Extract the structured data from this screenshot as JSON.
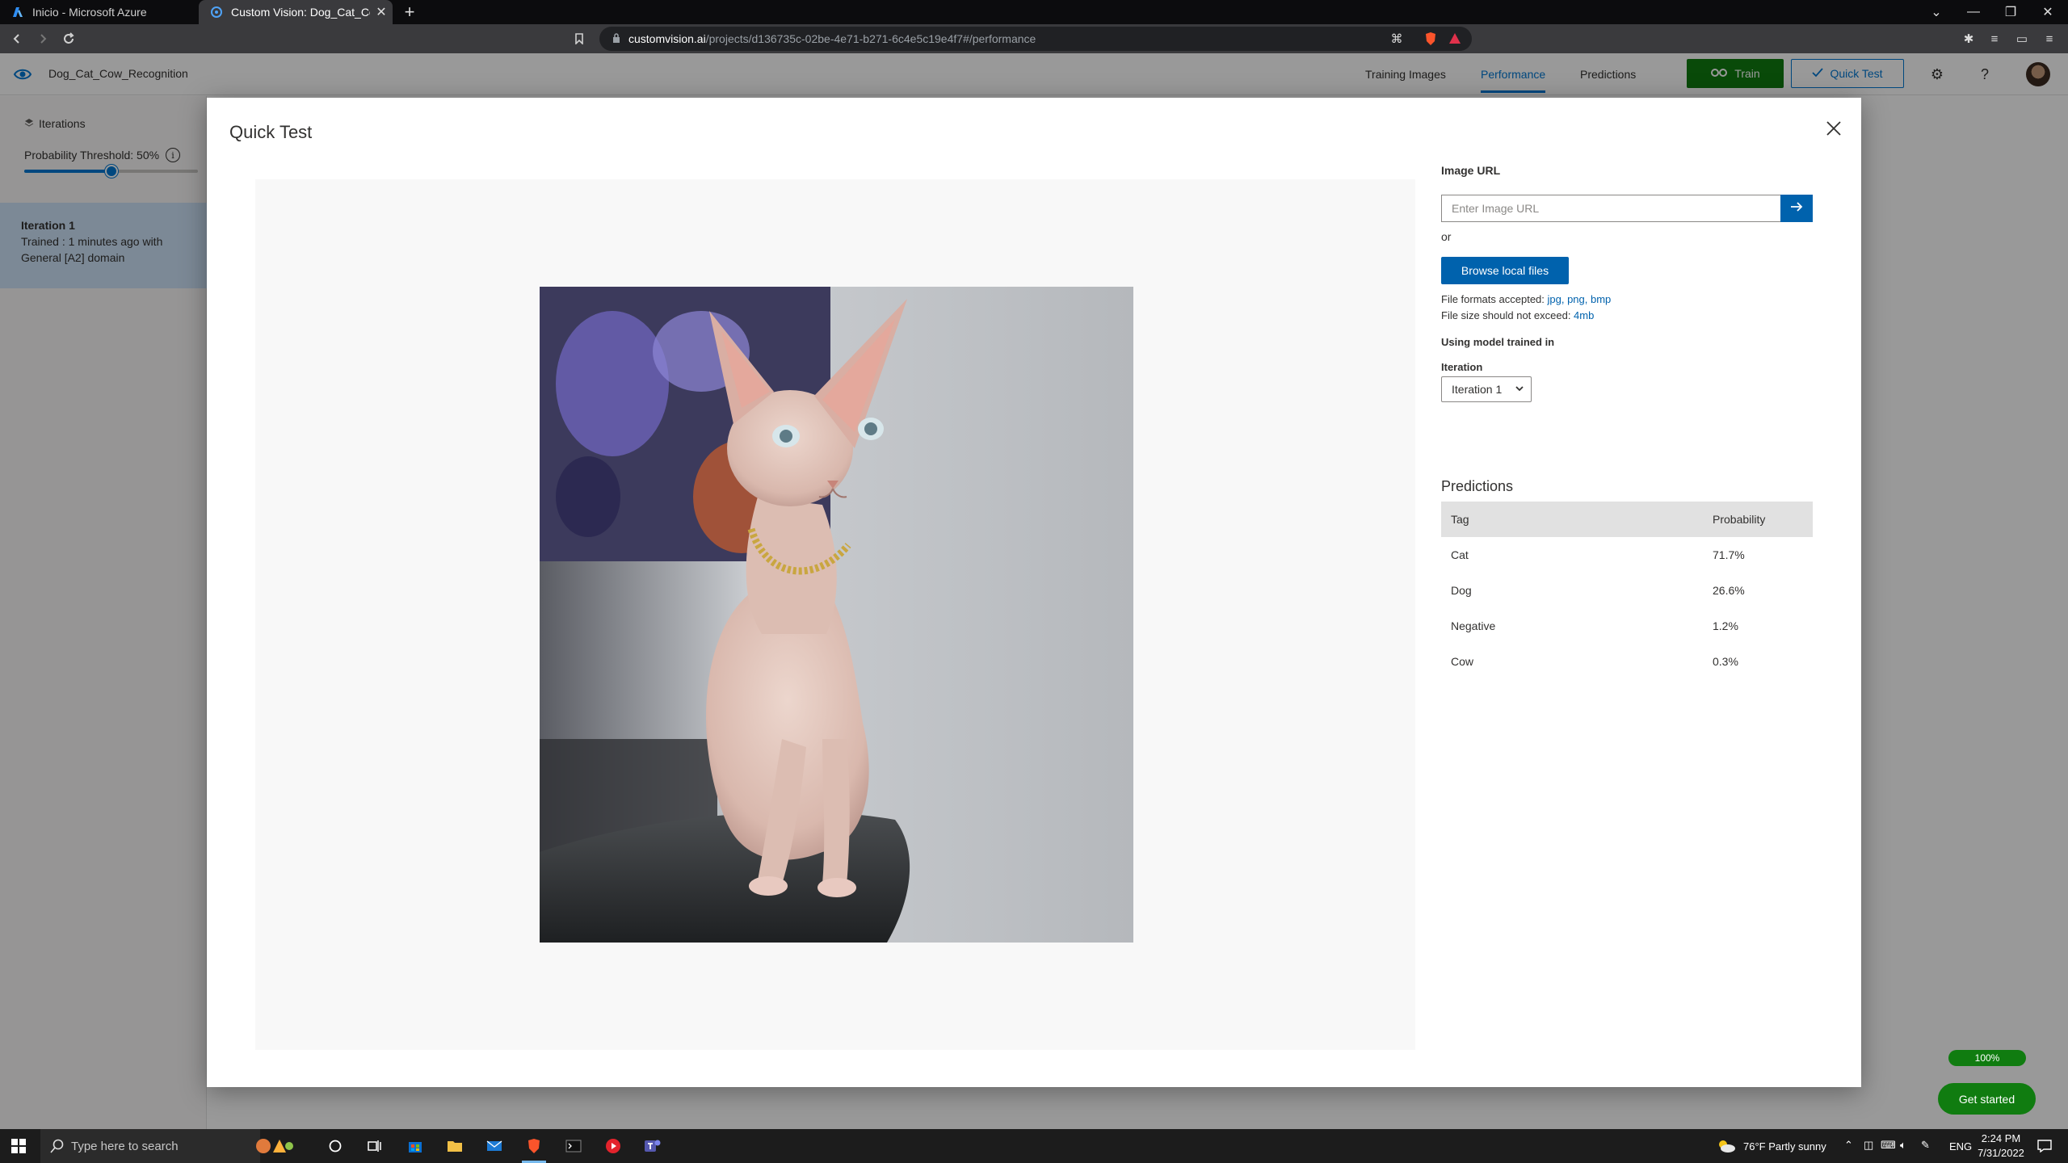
{
  "browser": {
    "tabs": [
      {
        "title": "Inicio - Microsoft Azure",
        "active": false
      },
      {
        "title": "Custom Vision: Dog_Cat_Cow_Re",
        "active": true
      }
    ],
    "url_host": "customvision.ai",
    "url_path": "/projects/d136735c-02be-4e71-b271-6c4e5c19e4f7#/performance"
  },
  "app": {
    "project_name": "Dog_Cat_Cow_Recognition",
    "nav": [
      "Training Images",
      "Performance",
      "Predictions"
    ],
    "active_nav": "Performance",
    "train_label": "Train",
    "quick_test_label": "Quick Test",
    "accent_color": "#0078d4",
    "train_color": "#107c10",
    "sidebar": {
      "iterations_title": "Iterations",
      "threshold_label": "Probability Threshold: 50%",
      "threshold_value": 0.5,
      "iteration": {
        "name": "Iteration 1",
        "trained": "Trained : 1 minutes ago with",
        "domain": "General [A2] domain"
      }
    },
    "zoom_badge": "100%",
    "get_started": "Get started"
  },
  "dialog": {
    "title": "Quick Test",
    "image_url_label": "Image URL",
    "image_url_placeholder": "Enter Image URL",
    "or_label": "or",
    "browse_label": "Browse local files",
    "formats_prefix": "File formats accepted: ",
    "formats": "jpg, png, bmp",
    "size_prefix": "File size should not exceed: ",
    "size": "4mb",
    "model_label": "Using model trained in",
    "iteration_label": "Iteration",
    "iteration_selected": "Iteration 1",
    "predictions_title": "Predictions",
    "columns": [
      "Tag",
      "Probability"
    ],
    "predictions": [
      {
        "tag": "Cat",
        "probability": "71.7%"
      },
      {
        "tag": "Dog",
        "probability": "26.6%"
      },
      {
        "tag": "Negative",
        "probability": "1.2%"
      },
      {
        "tag": "Cow",
        "probability": "0.3%"
      }
    ]
  },
  "taskbar": {
    "search_placeholder": "Type here to search",
    "weather": "76°F  Partly sunny",
    "language": "ENG",
    "time": "2:24 PM",
    "date": "7/31/2022"
  }
}
